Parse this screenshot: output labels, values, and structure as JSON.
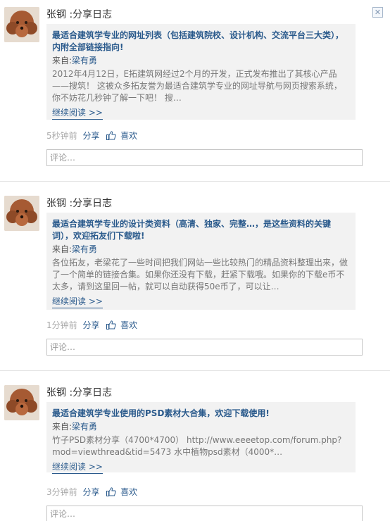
{
  "items": [
    {
      "author": "张钢",
      "action": ":分享日志",
      "title": "最适合建筑学专业的网址列表（包括建筑院校、设计机构、交流平台三大类），内附全部链接指向!",
      "from_label": "来自:",
      "from_name": "梁有勇",
      "summary": "2012年4月12日，E拓建筑网经过2个月的开发，正式发布推出了其核心产品——搜筑！ 这被众多拓友誉为最适合建筑学专业的网址导航与网页搜索系统，你不妨花几秒钟了解一下吧！ 搜…",
      "more": "继续阅读 >>",
      "time": "5秒钟前",
      "share": "分享",
      "like": "喜欢",
      "comment_placeholder": "评论…"
    },
    {
      "author": "张钢",
      "action": ":分享日志",
      "title": "最适合建筑学专业的设计类资料（高清、独家、完整…，是这些资料的关键词），欢迎拓友们下载啦!",
      "from_label": "来自:",
      "from_name": "梁有勇",
      "summary": "各位拓友，老梁花了一些时间把我们网站一些比较热门的精品资料整理出来，做了一个简单的链接合集。如果你还没有下载，赶紧下载哦。如果你的下载e币不太多，请到这里回一帖，就可以自动获得50e币了，可以让…",
      "more": "继续阅读 >>",
      "time": "1分钟前",
      "share": "分享",
      "like": "喜欢",
      "comment_placeholder": "评论…"
    },
    {
      "author": "张钢",
      "action": ":分享日志",
      "title": "最适合建筑学专业使用的PSD素材大合集，欢迎下载使用!",
      "from_label": "来自:",
      "from_name": "梁有勇",
      "summary": "竹子PSD素材分享（4700*4700） http://www.eeeetop.com/forum.php?mod=viewthread&tid=5473 水中植物psd素材（4000*…",
      "more": "继续阅读 >>",
      "time": "3分钟前",
      "share": "分享",
      "like": "喜欢",
      "comment_placeholder": "评论…"
    }
  ],
  "icons": {
    "close": "close-icon",
    "like": "thumbs-up-icon",
    "avatar": "poodle-avatar"
  },
  "colors": {
    "link": "#2a5a8c",
    "card_bg": "#f2f2f2",
    "meta": "#aaaaaa"
  }
}
